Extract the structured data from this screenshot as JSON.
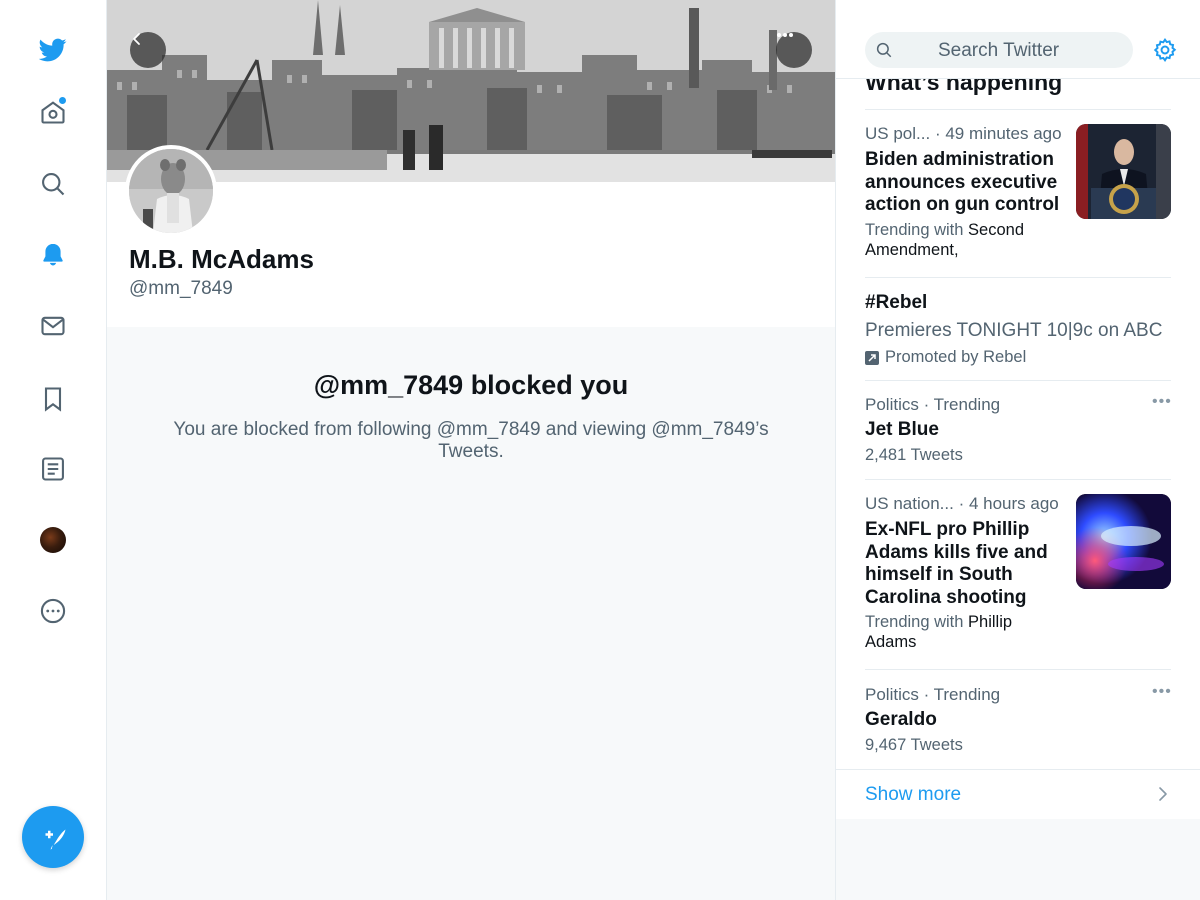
{
  "profile": {
    "display_name": "M.B. McAdams",
    "handle": "@mm_7849"
  },
  "blocked": {
    "title": "@mm_7849 blocked you",
    "description": "You are blocked from following @mm_7849 and viewing @mm_7849’s Tweets."
  },
  "nav": {
    "icons": [
      "twitter-logo-icon",
      "home-icon",
      "search-icon",
      "bell-icon",
      "mail-icon",
      "bookmark-icon",
      "list-icon",
      "profile-avatar",
      "more-icon"
    ],
    "compose_icon": "compose-tweet-icon"
  },
  "search": {
    "placeholder": "Search Twitter"
  },
  "trends": {
    "heading": "What’s happening",
    "items": [
      {
        "category": "US pol...",
        "time": "· 49 minutes ago",
        "headline": "Biden administration announces executive action on gun control",
        "trending_prefix": "Trending with",
        "trending_with": "Second Amendment,"
      },
      {
        "name": "#Rebel",
        "description": "Premieres TONIGHT 10|9c on ABC",
        "promoted": "Promoted by Rebel"
      },
      {
        "context": "Politics · Trending",
        "name": "Jet Blue",
        "count": "2,481 Tweets"
      },
      {
        "category": "US nation...",
        "time": "· 4 hours ago",
        "headline": "Ex-NFL pro Phillip Adams kills five and himself in South Carolina shooting",
        "trending_prefix": "Trending with",
        "trending_with": "Phillip Adams"
      },
      {
        "context": "Politics · Trending",
        "name": "Geraldo",
        "count": "9,467 Tweets"
      }
    ],
    "show_more": "Show more"
  },
  "colors": {
    "accent": "#1d9bf0",
    "secondary_text": "#536471",
    "primary_text": "#0f1419"
  }
}
